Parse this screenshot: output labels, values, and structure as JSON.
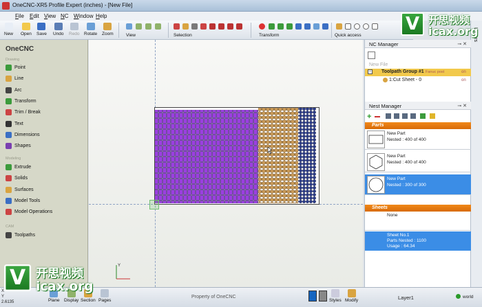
{
  "window": {
    "title": "OneCNC-XR5 Profile Expert (inches) - [New File]"
  },
  "menu": [
    "File",
    "Edit",
    "View",
    "NC",
    "Window",
    "Help"
  ],
  "toolbar": {
    "buttons": [
      {
        "label": "New",
        "color": "#e8eef6"
      },
      {
        "label": "Open",
        "color": "#f2c94c"
      },
      {
        "label": "Save",
        "color": "#3b6fc4"
      },
      {
        "label": "Undo",
        "color": "#5a7db5"
      },
      {
        "label": "Redo",
        "color": "#b9c4d3"
      },
      {
        "label": "Rotate",
        "color": "#6a9fd6"
      },
      {
        "label": "Zoom",
        "color": "#d9a441"
      }
    ],
    "groups": {
      "view": "View",
      "selection": "Selection",
      "transform": "Transform",
      "quick_access": "Quick access"
    }
  },
  "left_panel": {
    "title": "OneCNC",
    "sections": {
      "drawing": "Drawing",
      "modeling": "Modeling",
      "cam": "CAM"
    },
    "drawing_items": [
      {
        "label": "Point",
        "icon": "point-icon",
        "color": "#3c9b3c"
      },
      {
        "label": "Line",
        "icon": "line-icon",
        "color": "#d9a441"
      },
      {
        "label": "Arc",
        "icon": "arc-icon",
        "color": "#444444"
      },
      {
        "label": "Transform",
        "icon": "transform-icon",
        "color": "#3c9b3c"
      },
      {
        "label": "Trim / Break",
        "icon": "trim-icon",
        "color": "#cc4444"
      },
      {
        "label": "Text",
        "icon": "text-icon",
        "color": "#333333"
      },
      {
        "label": "Dimensions",
        "icon": "dimensions-icon",
        "color": "#3b6fc4"
      },
      {
        "label": "Shapes",
        "icon": "shapes-icon",
        "color": "#7a3fb0"
      }
    ],
    "modeling_items": [
      {
        "label": "Extrude",
        "icon": "extrude-icon",
        "color": "#3c9b3c"
      },
      {
        "label": "Solids",
        "icon": "solids-icon",
        "color": "#cc4444"
      },
      {
        "label": "Surfaces",
        "icon": "surfaces-icon",
        "color": "#d9a441"
      },
      {
        "label": "Model Tools",
        "icon": "model-tools-icon",
        "color": "#3b6fc4"
      },
      {
        "label": "Model Operations",
        "icon": "model-operations-icon",
        "color": "#cc4444"
      }
    ],
    "cam_items": [
      {
        "label": "Toolpaths",
        "icon": "toolpaths-icon",
        "color": "#444444"
      }
    ]
  },
  "canvas": {
    "sheet_colors": {
      "purple": "#9b3fe0",
      "tan": "#c99a58",
      "navy": "#2b3c8a"
    }
  },
  "side_tab": "Layers",
  "nc_manager": {
    "title": "NC Manager",
    "placeholder": "New File",
    "group": {
      "label": "Toolpath Group #1",
      "machine": "Fanuc post",
      "state": "on"
    },
    "item": {
      "label": "1:Cut Sheet - 0",
      "state": "on"
    }
  },
  "nest_manager": {
    "title": "Nest Manager",
    "parts_header": "Parts",
    "parts": [
      {
        "name": "New Part",
        "nested": "Nested : 400 of 400",
        "shape": "rectangle",
        "selected": false
      },
      {
        "name": "New Part",
        "nested": "Nested : 400 of 400",
        "shape": "hexagon",
        "selected": false
      },
      {
        "name": "New Part",
        "nested": "Nested : 300 of 300",
        "shape": "circle",
        "selected": true
      }
    ],
    "sheets_header": "Sheets",
    "sheets": {
      "none_label": "None",
      "sheet": {
        "name": "Sheet No.1",
        "parts_nested": "Parts Nested : 1100",
        "usage": "Usage : 64.34"
      }
    }
  },
  "status": {
    "coords": {
      "x": "X",
      "y": "Y",
      "z": "2.6135"
    },
    "buttons": [
      "Plane",
      "Display",
      "Section",
      "Pages"
    ],
    "center_text": "Property of OneCNC",
    "styles_label": "Styles",
    "modify_label": "Modify",
    "layer": "Layer1",
    "world": "world",
    "accent_blue": "#1565c0"
  },
  "watermark": {
    "cn": "开思视频",
    "url": "icax.org",
    "letter": "V"
  }
}
